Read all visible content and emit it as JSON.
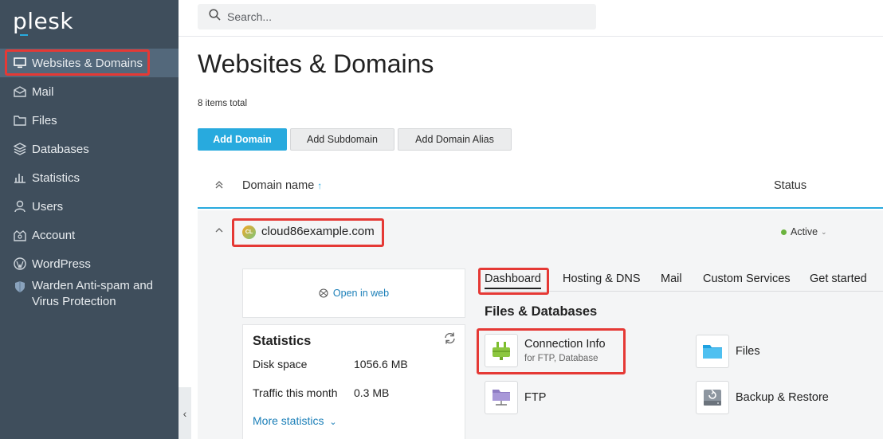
{
  "app": {
    "logo": "plesk"
  },
  "search": {
    "placeholder": "Search..."
  },
  "sidebar": {
    "items": [
      {
        "label": "Websites & Domains",
        "icon": "monitor-icon",
        "active": true
      },
      {
        "label": "Mail",
        "icon": "mail-icon"
      },
      {
        "label": "Files",
        "icon": "folder-icon"
      },
      {
        "label": "Databases",
        "icon": "database-icon"
      },
      {
        "label": "Statistics",
        "icon": "bar-chart-icon"
      },
      {
        "label": "Users",
        "icon": "user-icon"
      },
      {
        "label": "Account",
        "icon": "account-icon"
      },
      {
        "label": "WordPress",
        "icon": "wordpress-icon"
      },
      {
        "label_line1": "Warden Anti-spam and",
        "label_line2": "Virus Protection",
        "icon": "shield-icon"
      }
    ],
    "collapse_glyph": "‹"
  },
  "page": {
    "title": "Websites & Domains",
    "count": "8 items total"
  },
  "actions": {
    "add_domain": "Add Domain",
    "add_subdomain": "Add Subdomain",
    "add_alias": "Add Domain Alias"
  },
  "table": {
    "col_domain": "Domain name",
    "col_status": "Status",
    "sort_arrow": "↑"
  },
  "domain": {
    "badge": "CL",
    "name": "cloud86example.com",
    "status": "Active",
    "open_in_web": "Open in web"
  },
  "statistics": {
    "title": "Statistics",
    "rows": [
      {
        "label": "Disk space",
        "value": "1056.6 MB"
      },
      {
        "label": "Traffic this month",
        "value": "0.3 MB"
      }
    ],
    "more": "More statistics"
  },
  "tabs": [
    "Dashboard",
    "Hosting & DNS",
    "Mail",
    "Custom Services",
    "Get started"
  ],
  "files_section": {
    "title": "Files & Databases",
    "tools": [
      {
        "name": "Connection Info",
        "sub": "for FTP, Database",
        "icon": "plug-icon"
      },
      {
        "name": "Files",
        "icon": "folder-icon"
      },
      {
        "name": "FTP",
        "icon": "ftp-folder-icon"
      },
      {
        "name": "Backup & Restore",
        "icon": "backup-drive-icon"
      }
    ]
  },
  "colors": {
    "sidebar_bg": "#3f4e5c",
    "accent": "#28aade",
    "highlight": "#e53935",
    "active_status": "#6bb33e"
  }
}
